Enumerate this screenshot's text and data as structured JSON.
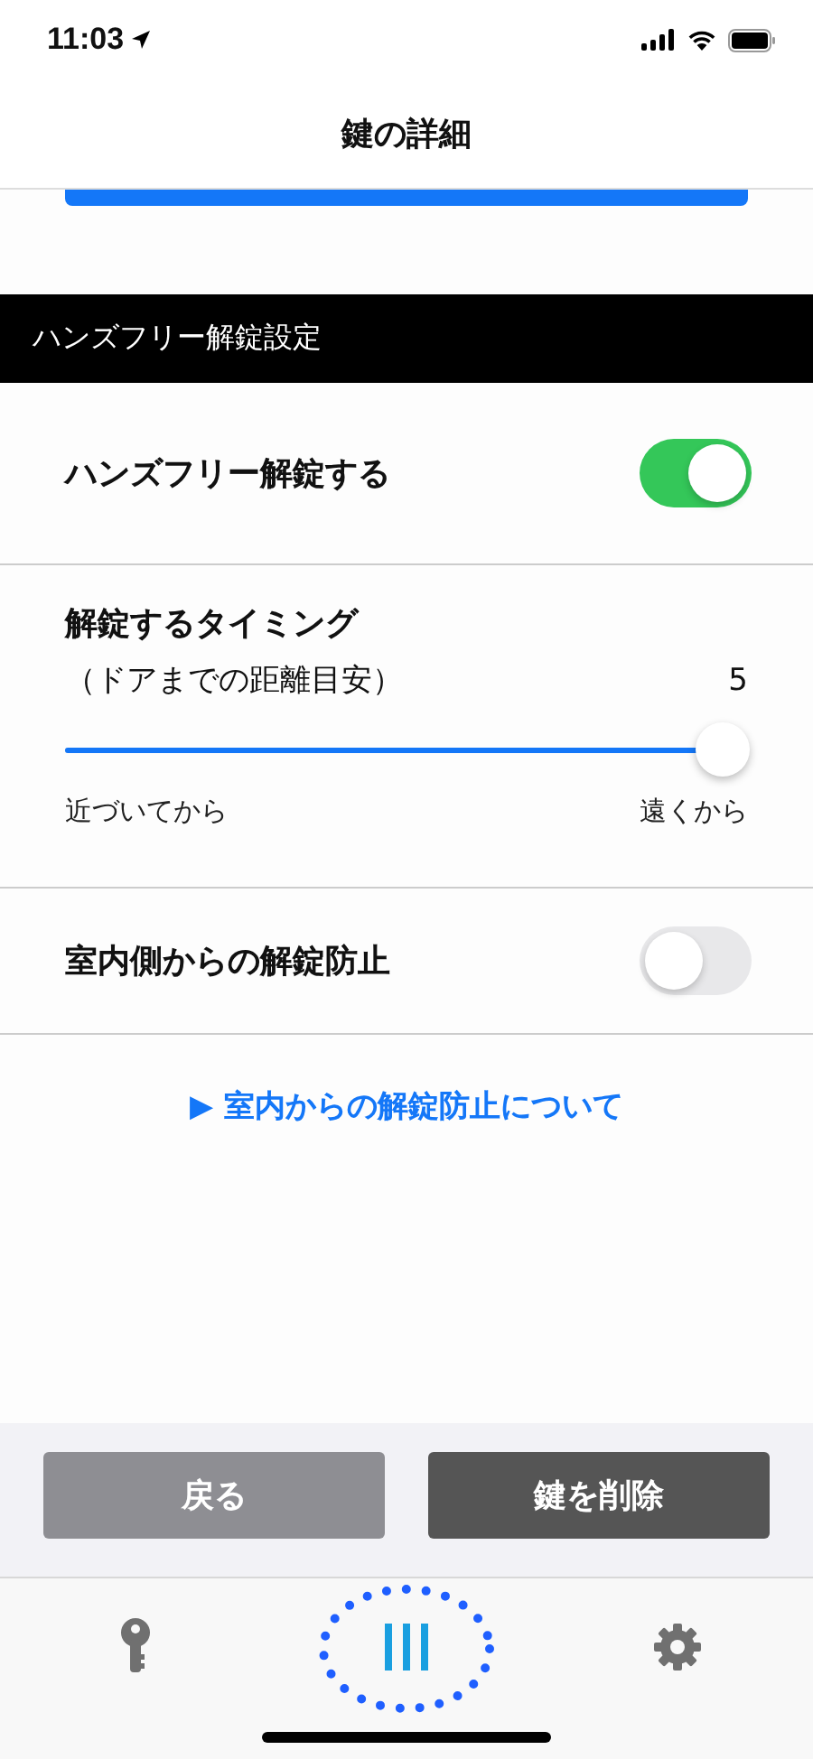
{
  "status_bar": {
    "time": "11:03"
  },
  "nav": {
    "title": "鍵の詳細"
  },
  "section": {
    "title": "ハンズフリー解錠設定"
  },
  "handsfree": {
    "label": "ハンズフリー解錠する",
    "on": true
  },
  "timing": {
    "title": "解錠するタイミング",
    "subtitle": "（ドアまでの距離目安）",
    "value": "5",
    "level": 1,
    "min_label": "近づいてから",
    "max_label": "遠くから"
  },
  "indoor_lock": {
    "label": "室内側からの解錠防止",
    "on": false
  },
  "link": {
    "arrow": "▶",
    "text": "室内からの解錠防止について"
  },
  "buttons": [
    {
      "label": "戻る",
      "kind": "secondary"
    },
    {
      "label": "鍵を削除",
      "kind": "danger"
    }
  ],
  "tabs": [
    {
      "kind": "key",
      "selected": false
    },
    {
      "kind": "list",
      "selected": true
    },
    {
      "kind": "settings",
      "selected": false
    }
  ]
}
